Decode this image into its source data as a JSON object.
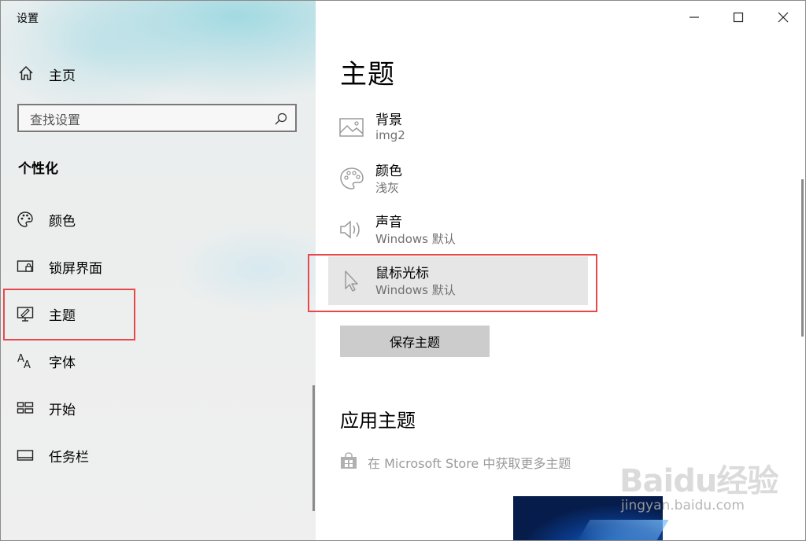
{
  "window": {
    "title": "设置",
    "controls": {
      "minimize": "minimize-icon",
      "maximize": "maximize-icon",
      "close": "close-icon"
    }
  },
  "sidebar": {
    "home_label": "主页",
    "search": {
      "placeholder": "查找设置",
      "value": ""
    },
    "section_title": "个性化",
    "items": [
      {
        "label": "颜色",
        "icon": "palette-icon"
      },
      {
        "label": "锁屏界面",
        "icon": "lock-screen-icon"
      },
      {
        "label": "主题",
        "icon": "theme-icon"
      },
      {
        "label": "字体",
        "icon": "font-icon"
      },
      {
        "label": "开始",
        "icon": "start-icon"
      },
      {
        "label": "任务栏",
        "icon": "taskbar-icon"
      }
    ]
  },
  "main": {
    "title": "主题",
    "theme_settings": [
      {
        "label": "背景",
        "value": "img2",
        "icon": "picture-icon"
      },
      {
        "label": "颜色",
        "value": "浅灰",
        "icon": "palette-icon"
      },
      {
        "label": "声音",
        "value": "Windows 默认",
        "icon": "speaker-icon"
      },
      {
        "label": "鼠标光标",
        "value": "Windows 默认",
        "icon": "cursor-icon"
      }
    ],
    "save_button": "保存主题",
    "apply_title": "应用主题",
    "store_link": "在 Microsoft Store 中获取更多主题"
  },
  "watermark": {
    "brand": "Baidu经验",
    "site": "jingyan.baidu.com"
  },
  "colors": {
    "highlight": "#e8484a",
    "selected_row": "#e6e6e6",
    "button": "#cccccc",
    "secondary_text": "#707070"
  }
}
